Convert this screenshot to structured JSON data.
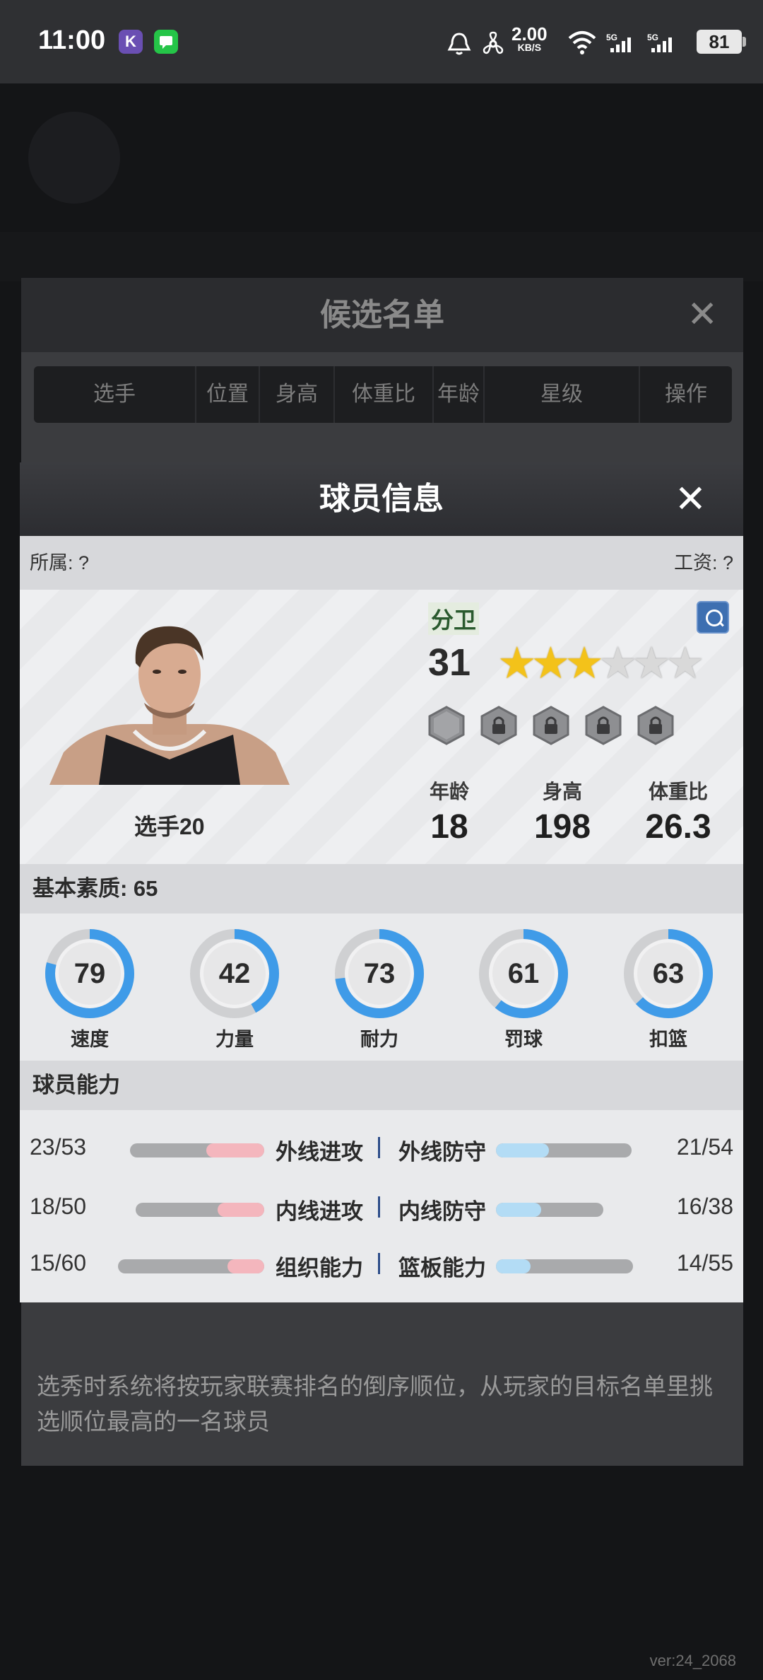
{
  "status_bar": {
    "time": "11:00",
    "app_icons": [
      "K",
      "msg"
    ],
    "net_speed": "2.00",
    "net_unit": "KB/S",
    "signal_1": "5G",
    "signal_2": "5G",
    "battery": "81"
  },
  "background": {
    "panel_title": "候选名单",
    "close": "✕",
    "columns": [
      "选手",
      "位置",
      "身高",
      "体重比",
      "年龄",
      "星级",
      "操作"
    ],
    "hint": "选秀时系统将按玩家联赛排名的倒序顺位，从玩家的目标名单里挑选顺位最高的一名球员",
    "version": "ver:24_2068"
  },
  "modal": {
    "title": "球员信息",
    "close": "✕",
    "affiliation": "所属: ?",
    "salary": "工资: ?",
    "player": {
      "name": "选手20",
      "position": "分卫",
      "rating": "31",
      "stars_filled": 3,
      "stars_total": 6,
      "age_label": "年龄",
      "age": "18",
      "height_label": "身高",
      "height": "198",
      "bmi_label": "体重比",
      "bmi": "26.3"
    },
    "basic_title": "基本素质: 65",
    "attributes": [
      {
        "label": "速度",
        "value": "79"
      },
      {
        "label": "力量",
        "value": "42"
      },
      {
        "label": "耐力",
        "value": "73"
      },
      {
        "label": "罚球",
        "value": "61"
      },
      {
        "label": "扣篮",
        "value": "63"
      }
    ],
    "ability_title": "球员能力",
    "abilities": [
      {
        "left_value": "23/53",
        "left_name": "外线进攻",
        "right_name": "外线防守",
        "right_value": "21/54"
      },
      {
        "left_value": "18/50",
        "left_name": "内线进攻",
        "right_name": "内线防守",
        "right_value": "16/38"
      },
      {
        "left_value": "15/60",
        "left_name": "组织能力",
        "right_name": "篮板能力",
        "right_value": "14/55"
      }
    ]
  }
}
